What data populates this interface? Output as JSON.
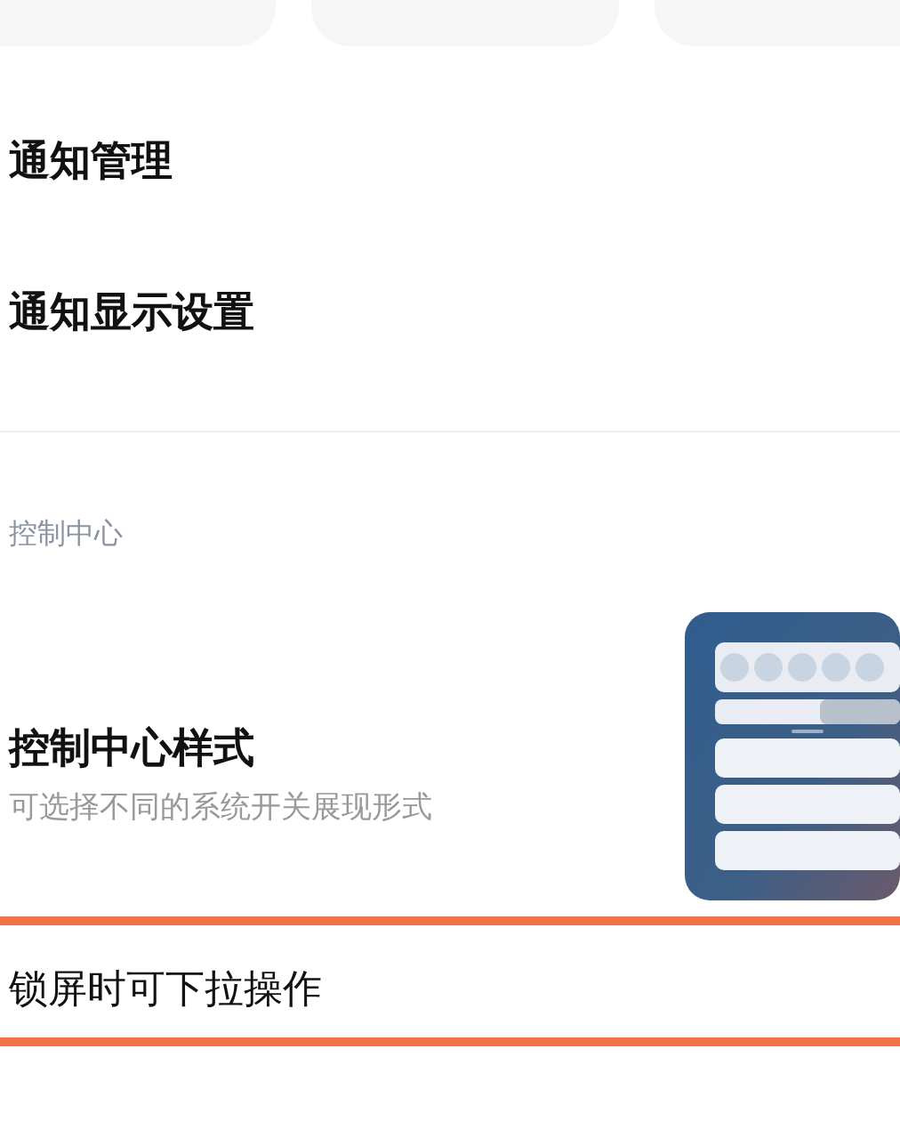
{
  "notification_items": [
    {
      "label": "通知管理"
    },
    {
      "label": "通知显示设置"
    }
  ],
  "section_header": "控制中心",
  "control_center_style": {
    "title": "控制中心样式",
    "subtitle": "可选择不同的系统开关展现形式"
  },
  "lock_screen_item": {
    "label": "锁屏时可下拉操作",
    "highlighted": true
  }
}
